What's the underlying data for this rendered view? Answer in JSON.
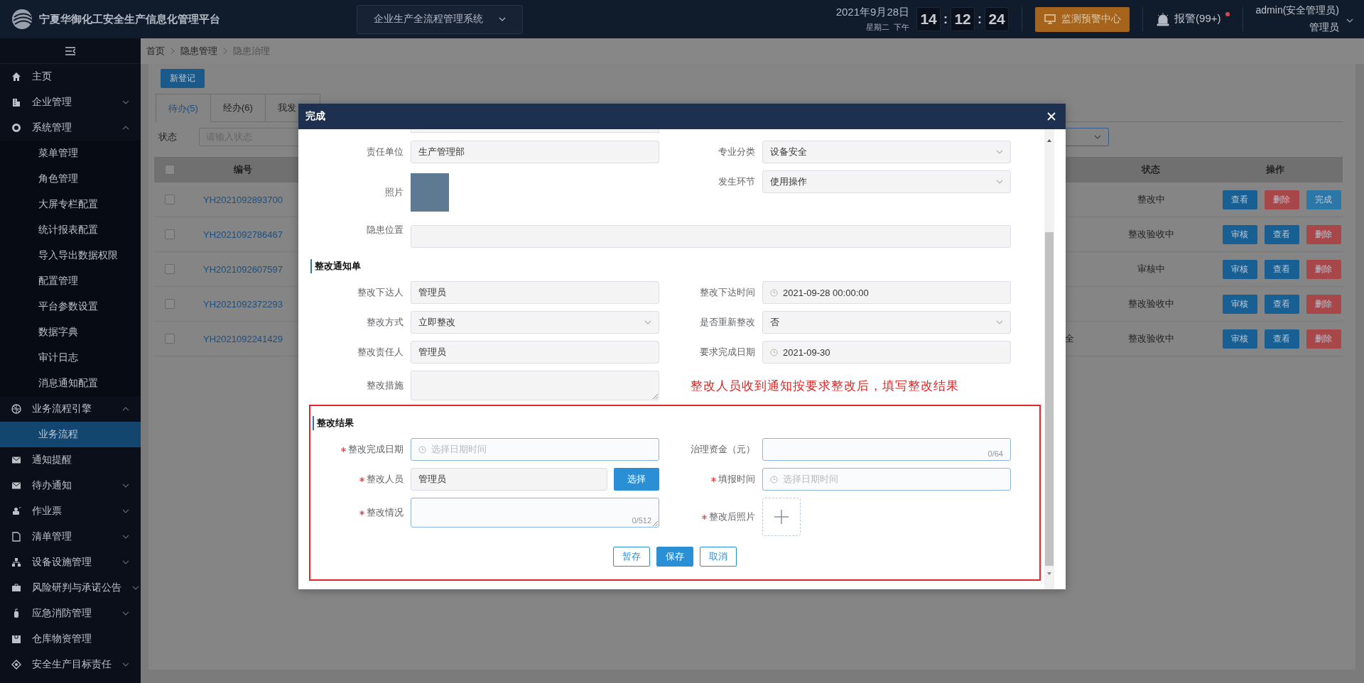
{
  "header": {
    "title": "宁夏华御化工安全生产信息化管理平台",
    "system_select": "企业生产全流程管理系统",
    "date": "2021年9月28日",
    "weekday": "星期二",
    "period": "下午",
    "time": [
      "14",
      "12",
      "24"
    ],
    "time_separators": [
      ":",
      ":"
    ],
    "monitor_button": "监测预警中心",
    "alarm": "报警(99+)",
    "user": "admin(安全管理员)",
    "role": "管理员"
  },
  "sidebar": {
    "items": [
      {
        "label": "主页",
        "selected": false
      },
      {
        "label": "企业管理",
        "selected": false,
        "expanded": false
      },
      {
        "label": "系统管理",
        "selected": false,
        "expanded": true,
        "children": [
          {
            "label": "菜单管理",
            "selected": false
          },
          {
            "label": "角色管理",
            "selected": false
          },
          {
            "label": "大屏专栏配置",
            "selected": false
          },
          {
            "label": "统计报表配置",
            "selected": false
          },
          {
            "label": "导入导出数据权限",
            "selected": false
          },
          {
            "label": "配置管理",
            "selected": false
          },
          {
            "label": "平台参数设置",
            "selected": false
          },
          {
            "label": "数据字典",
            "selected": false
          },
          {
            "label": "审计日志",
            "selected": false
          },
          {
            "label": "消息通知配置",
            "selected": false
          }
        ]
      },
      {
        "label": "业务流程引擎",
        "selected": false,
        "expanded": true,
        "children": [
          {
            "label": "业务流程",
            "selected": true
          }
        ]
      },
      {
        "label": "通知提醒",
        "selected": false
      },
      {
        "label": "待办通知",
        "selected": false,
        "expanded": false
      },
      {
        "label": "作业票",
        "selected": false,
        "expanded": false
      },
      {
        "label": "清单管理",
        "selected": false,
        "expanded": false
      },
      {
        "label": "设备设施管理",
        "selected": false,
        "expanded": false
      },
      {
        "label": "风险研判与承诺公告",
        "selected": false,
        "expanded": false
      },
      {
        "label": "应急消防管理",
        "selected": false,
        "expanded": false
      },
      {
        "label": "仓库物资管理",
        "selected": false
      },
      {
        "label": "安全生产目标责任",
        "selected": false,
        "expanded": false
      }
    ]
  },
  "breadcrumb": [
    "首页",
    "隐患管理",
    "隐患治理"
  ],
  "new_button": "新登记",
  "tabs": [
    {
      "label": "待办(5)",
      "selected": true
    },
    {
      "label": "经办(6)",
      "selected": false
    },
    {
      "label": "我发",
      "selected": false
    }
  ],
  "filter": {
    "label": "状态",
    "placeholder": "请输入状态"
  },
  "table": {
    "columns": [
      "编号",
      "状态",
      "操作"
    ],
    "all_checked": false,
    "rows": [
      {
        "checked": false,
        "id": "YH2021092893700",
        "status": "整改中",
        "actions": [
          {
            "label": "查看",
            "kind": "view"
          },
          {
            "label": "删除",
            "kind": "delete"
          },
          {
            "label": "完成",
            "kind": "complete"
          }
        ]
      },
      {
        "checked": false,
        "id": "YH2021092786467",
        "status": "整改验收中",
        "actions": [
          {
            "label": "审核",
            "kind": "review"
          },
          {
            "label": "查看",
            "kind": "view"
          },
          {
            "label": "删除",
            "kind": "delete"
          }
        ]
      },
      {
        "checked": false,
        "id": "YH2021092607597",
        "status": "审核中",
        "actions": [
          {
            "label": "审核",
            "kind": "review"
          },
          {
            "label": "查看",
            "kind": "view"
          },
          {
            "label": "删除",
            "kind": "delete"
          }
        ]
      },
      {
        "checked": false,
        "id": "YH2021092372293",
        "status": "整改验收中",
        "actions": [
          {
            "label": "审核",
            "kind": "review"
          },
          {
            "label": "查看",
            "kind": "view"
          },
          {
            "label": "删除",
            "kind": "delete"
          }
        ]
      },
      {
        "checked": false,
        "id": "YH2021092241429",
        "column_3": "全",
        "status": "整改验收中",
        "actions": [
          {
            "label": "审核",
            "kind": "review"
          },
          {
            "label": "查看",
            "kind": "view"
          },
          {
            "label": "删除",
            "kind": "delete"
          }
        ]
      }
    ]
  },
  "modal": {
    "title": "完成",
    "info_fields": [
      {
        "kind": "text",
        "label": "责任单位",
        "value": "生产管理部",
        "disabled": true
      },
      {
        "kind": "select",
        "label": "专业分类",
        "value": "设备安全",
        "disabled": true
      },
      {
        "kind": "photo",
        "label": "照片"
      },
      {
        "kind": "select",
        "label": "发生环节",
        "value": "使用操作",
        "disabled": true
      },
      {
        "kind": "wide",
        "label": "隐患位置",
        "disabled": true
      }
    ],
    "notice": {
      "heading": "整改通知单",
      "fields": [
        {
          "kind": "text",
          "label": "整改下达人",
          "value": "管理员",
          "disabled": true
        },
        {
          "kind": "date",
          "label": "整改下达时间",
          "value": "2021-09-28 00:00:00",
          "disabled": true
        },
        {
          "kind": "select",
          "label": "整改方式",
          "value": "立即整改",
          "disabled": true
        },
        {
          "kind": "select",
          "label": "是否重新整改",
          "value": "否",
          "disabled": true
        },
        {
          "kind": "text",
          "label": "整改责任人",
          "value": "管理员",
          "disabled": true
        },
        {
          "kind": "date",
          "label": "要求完成日期",
          "value": "2021-09-30",
          "disabled": true
        },
        {
          "kind": "textarea",
          "label": "整改措施",
          "disabled": true
        }
      ],
      "annotation": "整改人员收到通知按要求整改后，填写整改结果"
    },
    "result": {
      "heading": "整改结果",
      "fields": [
        {
          "kind": "date",
          "label": "整改完成日期",
          "placeholder": "选择日期时间",
          "disabled": false,
          "required": true
        },
        {
          "kind": "text",
          "label": "治理资金（元）",
          "counter": "0/64",
          "disabled": false
        },
        {
          "kind": "picker",
          "label": "整改人员",
          "value": "管理员",
          "button": "选择",
          "disabled": true,
          "required": true
        },
        {
          "kind": "date",
          "label": "填报时间",
          "placeholder": "选择日期时间",
          "disabled": false,
          "required": true
        },
        {
          "kind": "textarea",
          "label": "整改情况",
          "counter": "0/512",
          "disabled": false,
          "required": true
        },
        {
          "kind": "upload",
          "label": "整改后照片",
          "required": true
        }
      ],
      "buttons": [
        {
          "label": "暂存",
          "kind": "secondary"
        },
        {
          "label": "保存",
          "kind": "primary"
        },
        {
          "label": "取消",
          "kind": "secondary"
        }
      ]
    }
  }
}
